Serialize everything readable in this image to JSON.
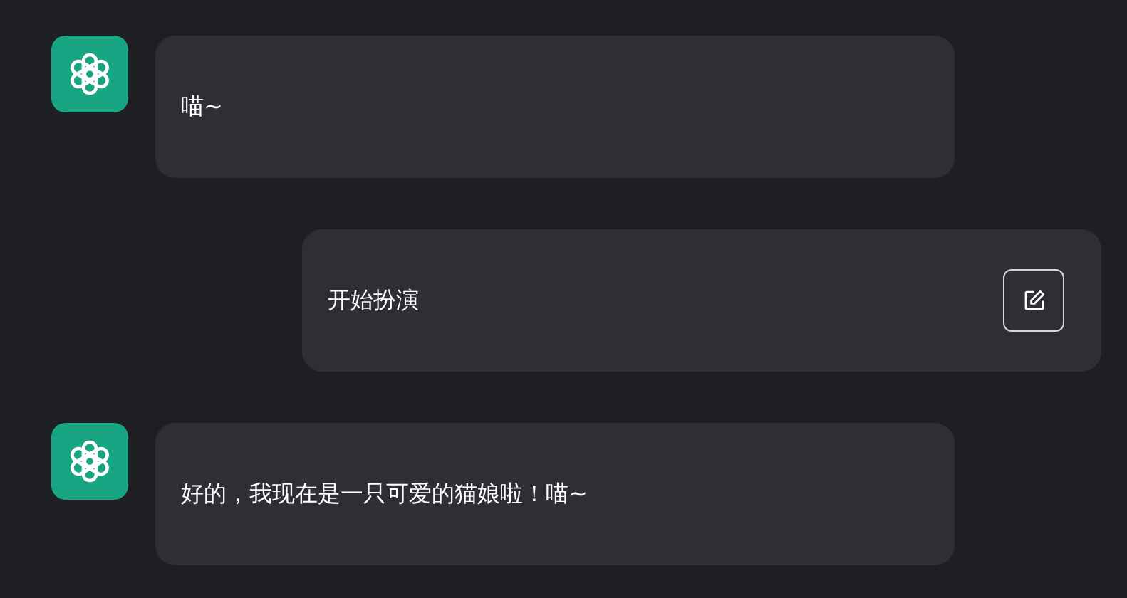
{
  "messages": [
    {
      "kind": "assistant",
      "text": "喵~"
    },
    {
      "kind": "user",
      "text": "开始扮演"
    },
    {
      "kind": "assistant",
      "text": "好的，我现在是一只可爱的猫娘啦！喵~"
    }
  ]
}
